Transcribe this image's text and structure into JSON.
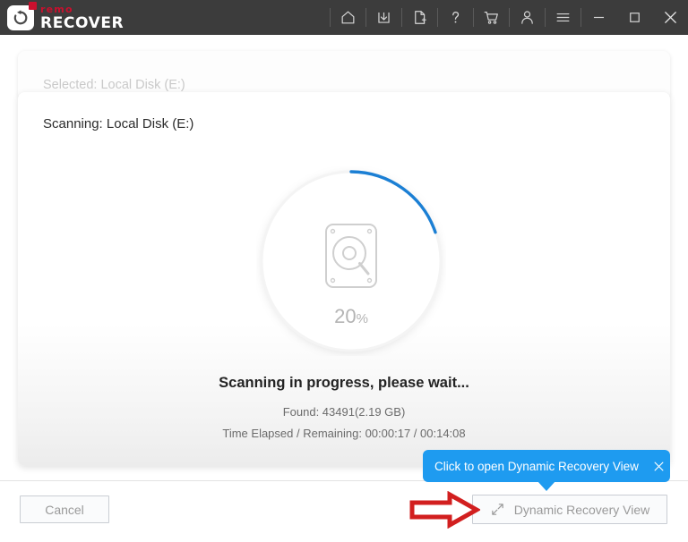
{
  "app": {
    "brand_top": "remo",
    "brand_bottom": "RECOVER",
    "titlebar_color": "#3c3c3c",
    "accent_color": "#1e9bf0",
    "brand_red": "#c8102e"
  },
  "titlebar": {
    "icons": [
      {
        "name": "home-icon",
        "label": "Home"
      },
      {
        "name": "download-icon",
        "label": "Save Recovery Session"
      },
      {
        "name": "new-file-icon",
        "label": "Open Recovery Session"
      },
      {
        "name": "help-icon",
        "label": "Help"
      },
      {
        "name": "cart-icon",
        "label": "Buy Now"
      },
      {
        "name": "user-icon",
        "label": "Account"
      },
      {
        "name": "menu-icon",
        "label": "Menu"
      }
    ],
    "window_controls": [
      {
        "name": "minimize-button",
        "label": "Minimize"
      },
      {
        "name": "maximize-button",
        "label": "Maximize"
      },
      {
        "name": "close-button",
        "label": "Close"
      }
    ]
  },
  "selected_card": {
    "label": "Selected: Local Disk (E:)"
  },
  "scan_card": {
    "label": "Scanning: Local Disk (E:)",
    "progress": {
      "percent_number": "20",
      "percent_symbol": "%",
      "percent_value": 20,
      "track_color": "#f1f1f1",
      "arc_color": "#1b7fd4",
      "icon": "hard-disk-search-icon"
    },
    "status_main": "Scanning in progress, please wait...",
    "status_found": "Found: 43491(2.19 GB)",
    "status_time": "Time Elapsed / Remaining:  00:00:17 / 00:14:08"
  },
  "tooltip": {
    "text": "Click to open Dynamic Recovery View",
    "background": "#1e9bf0",
    "close_icon": "close-icon"
  },
  "footer": {
    "cancel_label": "Cancel",
    "dynamic_view_label": "Dynamic Recovery View",
    "dynamic_view_icon": "expand-diagonal-icon"
  },
  "annotation": {
    "arrow": "red-pointer-arrow",
    "color": "#d21f1f"
  }
}
